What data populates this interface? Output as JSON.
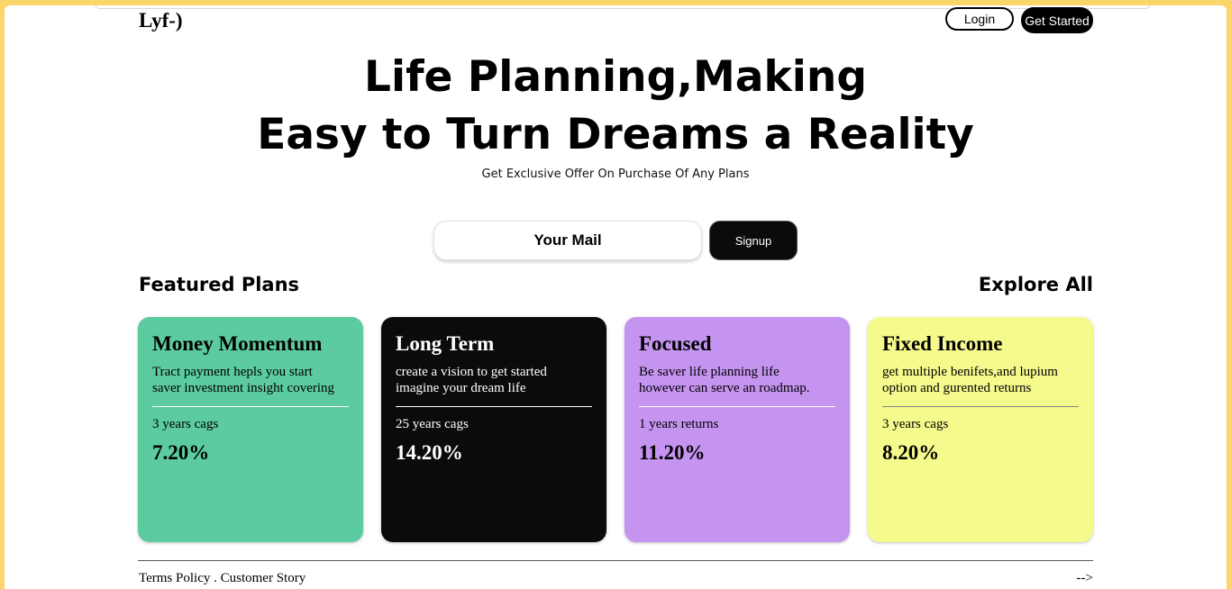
{
  "header": {
    "logo": "Lyf-)",
    "login_label": "Login",
    "get_started_label": "Get Started"
  },
  "hero": {
    "title_line1": "Life Planning,Making",
    "title_line2": "Easy to Turn Dreams a Reality",
    "subtitle": "Get Exclusive Offer On Purchase Of Any Plans"
  },
  "signup": {
    "placeholder": "Your Mail",
    "button_label": "Signup"
  },
  "plans_section": {
    "title": "Featured Plans",
    "explore_label": "Explore All"
  },
  "plans": [
    {
      "title": "Money Momentum",
      "desc_line1": "Tract payment hepls you start",
      "desc_line2": "saver investment insight covering",
      "stat": "3 years cags",
      "value": "7.20%",
      "bg": "#5ccb9f",
      "fg": "#000000",
      "rule": "#ffffff"
    },
    {
      "title": "Long Term",
      "desc_line1": "create a vision to get started",
      "desc_line2": "imagine your dream life",
      "stat": "25 years cags",
      "value": "14.20%",
      "bg": "#0b0b0b",
      "fg": "#ffffff",
      "rule": "#ffffff"
    },
    {
      "title": "Focused",
      "desc_line1": "Be saver life planning life",
      "desc_line2": "however can serve an roadmap.",
      "stat": "1 years returns",
      "value": "11.20%",
      "bg": "#c594f0",
      "fg": "#000000",
      "rule": "#ffffff"
    },
    {
      "title": "Fixed Income",
      "desc_line1": "get multiple benifets,and lupium",
      "desc_line2": "option and gurented returns",
      "stat": "3 years cags",
      "value": "8.20%",
      "bg": "#f5fa8c",
      "fg": "#000000",
      "rule": "#888888"
    }
  ],
  "footer": {
    "links": "Terms Policy . Customer Story",
    "arrow": "-->"
  }
}
